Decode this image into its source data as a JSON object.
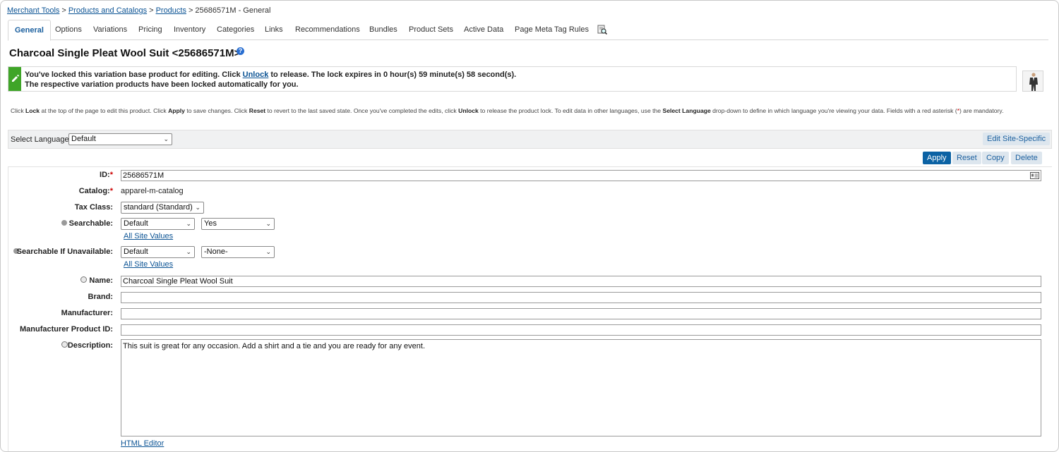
{
  "breadcrumb": {
    "merchant_tools": "Merchant Tools",
    "products_catalogs": "Products and Catalogs",
    "products": "Products",
    "current": "25686571M - General",
    "sep": ">"
  },
  "tabs": [
    {
      "label": "General",
      "active": true
    },
    {
      "label": "Options"
    },
    {
      "label": "Variations"
    },
    {
      "label": "Pricing"
    },
    {
      "label": "Inventory"
    },
    {
      "label": "Categories"
    },
    {
      "label": "Links"
    },
    {
      "label": "Recommendations"
    },
    {
      "label": "Bundles"
    },
    {
      "label": "Product Sets"
    },
    {
      "label": "Active Data"
    },
    {
      "label": "Page Meta Tag Rules"
    }
  ],
  "tab_extra_icon": "search-page-icon",
  "title": "Charcoal Single Pleat Wool Suit <25686571M>",
  "lock_message": {
    "pre": "You've locked this variation base product for editing. Click ",
    "unlock": "Unlock",
    "post": " to release. The lock expires in 0 hour(s) 59 minute(s) 58 second(s).",
    "line2": "The respective variation products have been locked automatically for you."
  },
  "hint": {
    "p1": "Click ",
    "b1": "Lock",
    "p2": " at the top of the page to edit this product. Click ",
    "b2": "Apply",
    "p3": " to save changes. Click ",
    "b3": "Reset",
    "p4": " to revert to the last saved state. Once you've completed the edits, click ",
    "b4": "Unlock",
    "p5": " to release the product lock. To edit data in other languages, use the ",
    "b5": "Select Language",
    "p6": " drop-down to define in which language you're viewing your data. Fields with a red asterisk (",
    "star": "*",
    "p7": ") are mandatory."
  },
  "language": {
    "label": "Select Language:",
    "value": "Default"
  },
  "buttons": {
    "edit_site_specific": "Edit Site-Specific",
    "apply": "Apply",
    "reset": "Reset",
    "copy": "Copy",
    "delete": "Delete"
  },
  "form": {
    "id": {
      "label": "ID:",
      "value": "25686571M"
    },
    "catalog": {
      "label": "Catalog:",
      "value": "apparel-m-catalog"
    },
    "tax_class": {
      "label": "Tax Class:",
      "value": "standard (Standard)"
    },
    "searchable": {
      "label": "Searchable:",
      "scope": "Default",
      "value": "Yes",
      "link": "All Site Values"
    },
    "searchable_unavailable": {
      "label": "Searchable If Unavailable:",
      "scope": "Default",
      "value": "-None-",
      "link": "All Site Values"
    },
    "name": {
      "label": "Name:",
      "value": "Charcoal Single Pleat Wool Suit"
    },
    "brand": {
      "label": "Brand:",
      "value": ""
    },
    "manufacturer": {
      "label": "Manufacturer:",
      "value": ""
    },
    "manufacturer_product_id": {
      "label": "Manufacturer Product ID:",
      "value": ""
    },
    "description": {
      "label": "Description:",
      "value": "This suit is great for any occasion. Add a shirt and a tie and you are ready for any event."
    },
    "html_editor": "HTML Editor",
    "required_mark": "*"
  },
  "colors": {
    "accent": "#0b62a4",
    "link": "#0b5394",
    "lock_green": "#3fa528",
    "required": "#cc0000"
  }
}
